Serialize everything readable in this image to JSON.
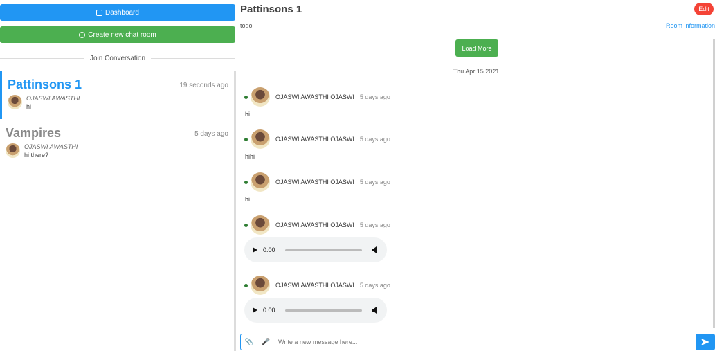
{
  "sidebar": {
    "dashboard_label": "Dashboard",
    "create_label": "Create new chat room",
    "join_label": "Join Conversation",
    "rooms": [
      {
        "title": "Pattinsons 1",
        "time": "19 seconds ago",
        "last_sender": "OJASWI AWASTHI",
        "last_message": "hi",
        "active": true
      },
      {
        "title": "Vampires",
        "time": "5 days ago",
        "last_sender": "OJASWI AWASTHI",
        "last_message": "hi there?",
        "active": false
      }
    ]
  },
  "main": {
    "room_name": "Pattinsons 1",
    "room_description": "todo",
    "edit_label": "Edit",
    "info_label": "Room information",
    "load_more_label": "Load More",
    "date_separator": "Thu Apr 15 2021",
    "messages": [
      {
        "sender": "OJASWI AWASTHI OJASWI",
        "time": "5 days ago",
        "text": "hi"
      },
      {
        "sender": "OJASWI AWASTHI OJASWI",
        "time": "5 days ago",
        "text": "hihi"
      },
      {
        "sender": "OJASWI AWASTHI OJASWI",
        "time": "5 days ago",
        "text": "hi"
      },
      {
        "sender": "OJASWI AWASTHI OJASWI",
        "time": "5 days ago",
        "audio_time": "0:00"
      },
      {
        "sender": "OJASWI AWASTHI OJASWI",
        "time": "5 days ago",
        "audio_time": "0:00"
      }
    ],
    "composer": {
      "placeholder": "Write a new message here..."
    }
  },
  "colors": {
    "primary": "#2196f3",
    "success": "#4caf50",
    "danger": "#f44336",
    "online": "#2e7d32"
  },
  "icons": {
    "dashboard": "dashboard-icon",
    "create": "lightbulb-icon",
    "attach": "paperclip-icon",
    "mic": "microphone-icon",
    "send": "send-icon"
  }
}
